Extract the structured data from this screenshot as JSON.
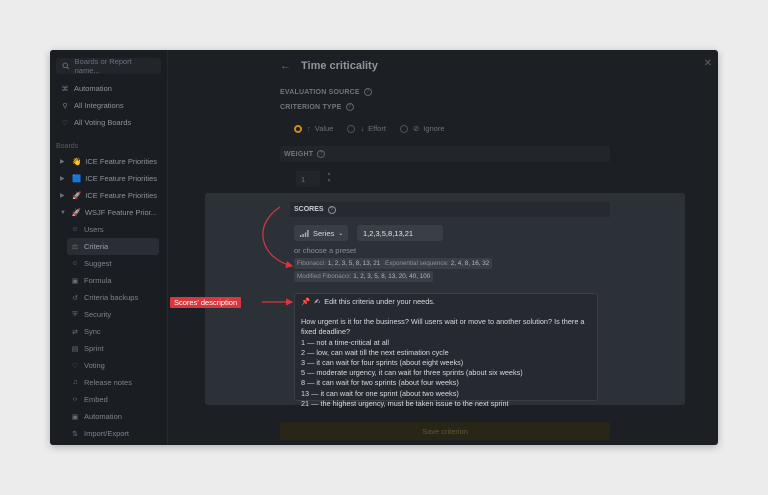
{
  "sidebar": {
    "search_placeholder": "Boards or Report name...",
    "top_items": [
      {
        "label": "Automation",
        "icon": "automation-icon"
      },
      {
        "label": "All Integrations",
        "icon": "integrations-icon"
      },
      {
        "label": "All Voting Boards",
        "icon": "voting-boards-icon"
      }
    ],
    "boards_section": "Boards",
    "boards": [
      {
        "label": "ICE Feature Priorities",
        "emoji": "👋"
      },
      {
        "label": "ICE Feature Priorities",
        "emoji": "🟦"
      },
      {
        "label": "ICE Feature Priorities",
        "emoji": "🚀"
      },
      {
        "label": "WSJF Feature Prior...",
        "emoji": "🚀"
      }
    ],
    "sub_items": [
      {
        "label": "Users",
        "icon": "users-icon"
      },
      {
        "label": "Criteria",
        "icon": "criteria-icon",
        "active": true
      },
      {
        "label": "Suggest",
        "icon": "suggest-icon"
      },
      {
        "label": "Formula",
        "icon": "formula-icon"
      },
      {
        "label": "Criteria backups",
        "icon": "backups-icon"
      },
      {
        "label": "Security",
        "icon": "security-icon"
      },
      {
        "label": "Sync",
        "icon": "sync-icon"
      },
      {
        "label": "Sprint",
        "icon": "sprint-icon"
      },
      {
        "label": "Voting",
        "icon": "voting-icon"
      },
      {
        "label": "Release notes",
        "icon": "release-notes-icon"
      },
      {
        "label": "Embed",
        "icon": "embed-icon"
      },
      {
        "label": "Automation",
        "icon": "automation-icon"
      },
      {
        "label": "Import/Export",
        "icon": "import-export-icon"
      }
    ]
  },
  "header": {
    "title": "Time criticality",
    "back_icon": "arrow-left-icon",
    "close_icon": "close-icon"
  },
  "form": {
    "evaluation_source_label": "EVALUATION SOURCE",
    "criterion_type_label": "CRITERION TYPE",
    "types": [
      {
        "label": "Value",
        "symbol": "↑",
        "selected": true
      },
      {
        "label": "Effort",
        "symbol": "↓",
        "selected": false
      },
      {
        "label": "Ignore",
        "symbol": "⊘",
        "selected": false
      }
    ],
    "weight_label": "WEIGHT",
    "weight_value": "1",
    "scores_label": "SCORES",
    "series_button": "Series",
    "series_value": "1,2,3,5,8,13,21",
    "preset_label": "or choose a preset",
    "presets": [
      {
        "name": "Fibonacci:",
        "values": "1, 2, 3, 5, 8, 13, 21"
      },
      {
        "name": "Exponential sequence:",
        "values": "2, 4, 8, 16, 32"
      },
      {
        "name": "Modified Fibonacci:",
        "values": "1, 2, 3, 5, 8, 13, 20, 40, 100"
      }
    ],
    "description_first_line": "Edit this criteria under your needs.",
    "description_lines": [
      "How urgent is it for the business? Will users wait or move to another solution? Is there a fixed deadline?",
      "1 — not a time-critical at all",
      "2 — low, can wait till the next estimation cycle",
      "3 — it can wait for four sprints (about eight weeks)",
      "5 — moderate urgency, it can wait for three sprints (about six weeks)",
      "8 — it can wait for two sprints (about four weeks)",
      "13 — it can wait for one sprint (about two weeks)",
      "21 — the highest urgency, must be taken issue to the next sprint"
    ],
    "save_button": "Save criterion"
  },
  "annotation": {
    "callout": "Scores' description",
    "accent_color": "#d9363e"
  }
}
